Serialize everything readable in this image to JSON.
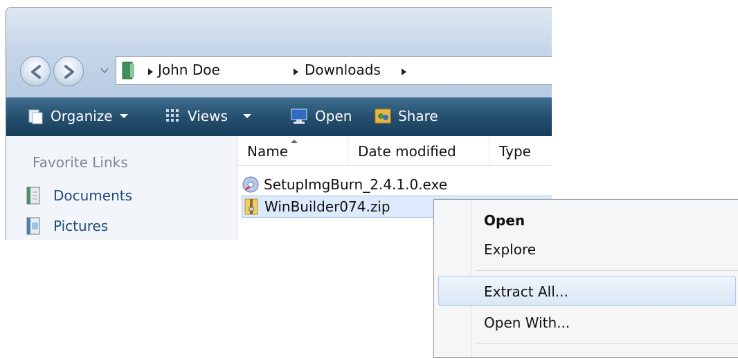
{
  "address": {
    "crumbs": [
      "John Doe",
      "Downloads"
    ]
  },
  "toolbar": {
    "organize": "Organize",
    "views": "Views",
    "open": "Open",
    "share": "Share"
  },
  "sidebar": {
    "title": "Favorite Links",
    "items": [
      {
        "label": "Documents",
        "icon": "documents-icon"
      },
      {
        "label": "Pictures",
        "icon": "pictures-icon"
      }
    ]
  },
  "columns": [
    "Name",
    "Date modified",
    "Type"
  ],
  "files": [
    {
      "name": "SetupImgBurn_2.4.1.0.exe",
      "icon": "exe-installer-icon",
      "selected": false
    },
    {
      "name": "WinBuilder074.zip",
      "icon": "zip-folder-icon",
      "selected": true
    }
  ],
  "context_menu": {
    "items": [
      {
        "label": "Open",
        "bold": true
      },
      {
        "label": "Explore",
        "bold": false
      },
      {
        "label": "Extract All...",
        "bold": false,
        "highlighted": true
      },
      {
        "label": "Open With...",
        "bold": false
      }
    ]
  },
  "colors": {
    "toolbar": "#264f6f",
    "link": "#1e4d7b",
    "selection": "#dceafb",
    "menu_highlight": "#dae7f6"
  }
}
